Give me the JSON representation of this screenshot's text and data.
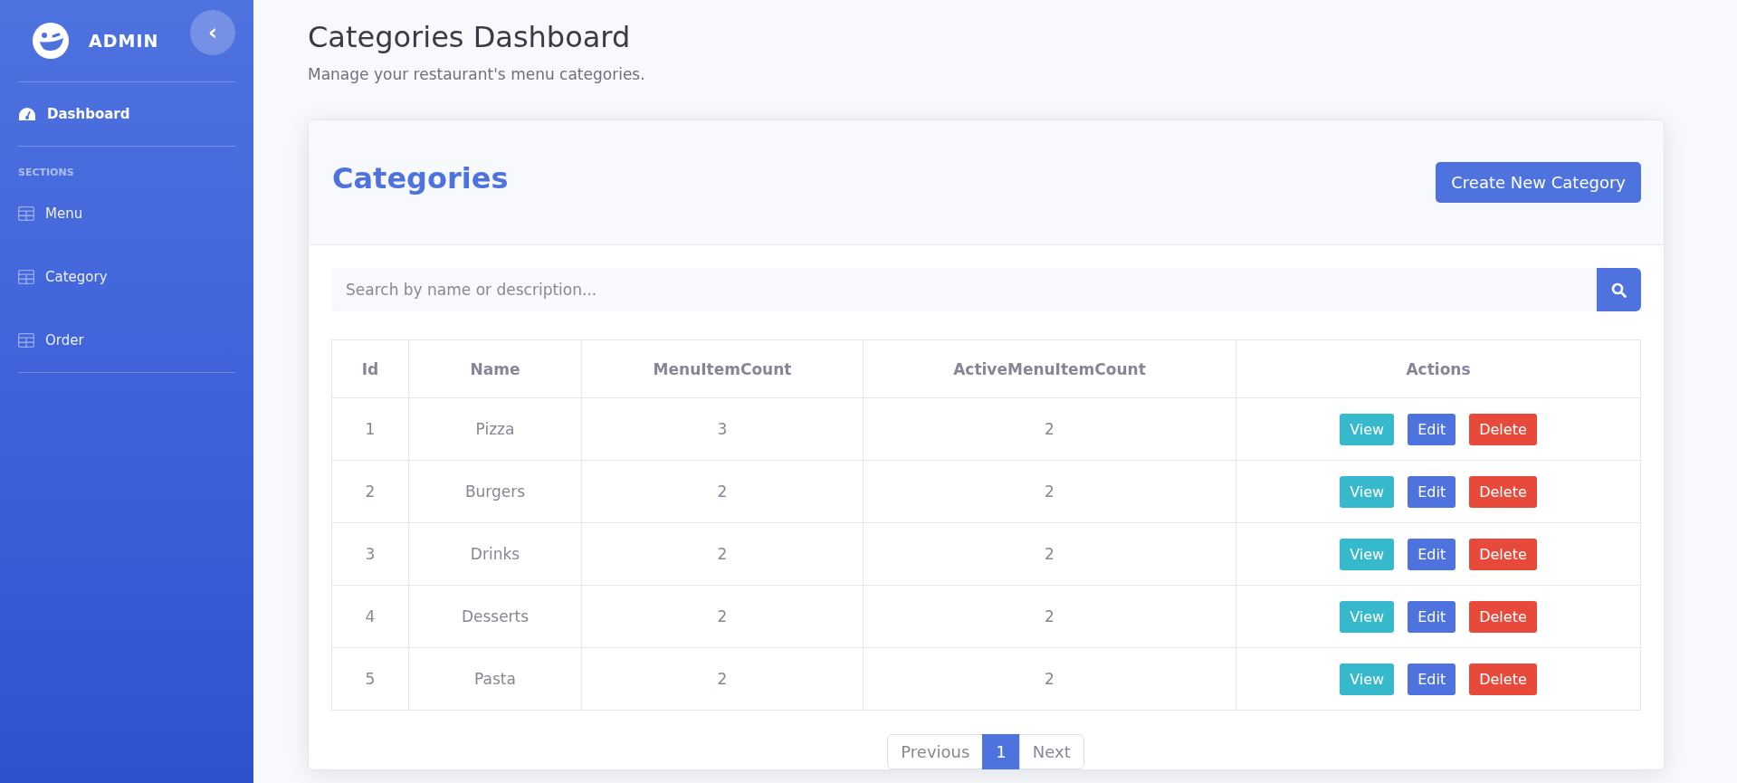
{
  "sidebar": {
    "brand": "ADMIN",
    "collapse_glyph": "‹",
    "items": [
      {
        "label": "Dashboard",
        "kind": "dashboard",
        "selected": true
      }
    ],
    "section_heading": "SECTIONS",
    "section_items": [
      {
        "label": "Menu",
        "selected": false
      },
      {
        "label": "Category",
        "selected": false
      },
      {
        "label": "Order",
        "selected": false
      }
    ]
  },
  "header": {
    "title": "Categories Dashboard",
    "subtitle": "Manage your restaurant's menu categories."
  },
  "card": {
    "title": "Categories",
    "create_button": "Create New Category",
    "search": {
      "placeholder": "Search by name or description..."
    },
    "table": {
      "columns": [
        "Id",
        "Name",
        "MenuItemCount",
        "ActiveMenuItemCount",
        "Actions"
      ],
      "rows": [
        {
          "id": "1",
          "name": "Pizza",
          "menu_item_count": "3",
          "active_menu_item_count": "2",
          "actions": [
            {
              "label": "View",
              "kind": "view"
            },
            {
              "label": "Edit",
              "kind": "edit"
            },
            {
              "label": "Delete",
              "kind": "delete"
            }
          ]
        },
        {
          "id": "2",
          "name": "Burgers",
          "menu_item_count": "2",
          "active_menu_item_count": "2",
          "actions": [
            {
              "label": "View",
              "kind": "view"
            },
            {
              "label": "Edit",
              "kind": "edit"
            },
            {
              "label": "Delete",
              "kind": "delete"
            }
          ]
        },
        {
          "id": "3",
          "name": "Drinks",
          "menu_item_count": "2",
          "active_menu_item_count": "2",
          "actions": [
            {
              "label": "View",
              "kind": "view"
            },
            {
              "label": "Edit",
              "kind": "edit"
            },
            {
              "label": "Delete",
              "kind": "delete"
            }
          ]
        },
        {
          "id": "4",
          "name": "Desserts",
          "menu_item_count": "2",
          "active_menu_item_count": "2",
          "actions": [
            {
              "label": "View",
              "kind": "view"
            },
            {
              "label": "Edit",
              "kind": "edit"
            },
            {
              "label": "Delete",
              "kind": "delete"
            }
          ]
        },
        {
          "id": "5",
          "name": "Pasta",
          "menu_item_count": "2",
          "active_menu_item_count": "2",
          "actions": [
            {
              "label": "View",
              "kind": "view"
            },
            {
              "label": "Edit",
              "kind": "edit"
            },
            {
              "label": "Delete",
              "kind": "delete"
            }
          ]
        }
      ]
    },
    "pagination": {
      "previous": "Previous",
      "pages": [
        {
          "label": "1",
          "selected": true
        }
      ],
      "next": "Next"
    }
  }
}
